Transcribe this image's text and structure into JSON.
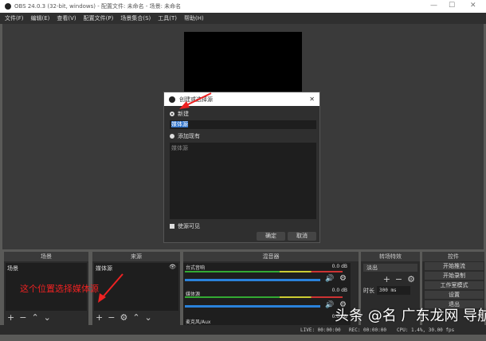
{
  "window": {
    "title": "OBS 24.0.3 (32-bit, windows) - 配置文件: 未命名 - 场景: 未命名",
    "min": "—",
    "max": "☐",
    "close": "✕"
  },
  "menu": [
    "文件(F)",
    "编辑(E)",
    "查看(V)",
    "配置文件(P)",
    "场景集合(S)",
    "工具(T)",
    "帮助(H)"
  ],
  "dialog": {
    "title": "创建或选择源",
    "new_label": "新建",
    "name_value": "媒体源",
    "existing_label": "添加现有",
    "existing_items": [
      "媒体源"
    ],
    "visible_label": "使源可见",
    "ok": "确定",
    "cancel": "取消"
  },
  "scenes": {
    "title": "场景",
    "items": [
      "场景"
    ]
  },
  "sources": {
    "title": "来源",
    "items": [
      "媒体源"
    ]
  },
  "annotation": "这个位置选择媒体源",
  "mixer": {
    "title": "混音器",
    "channels": [
      {
        "name": "台式音响",
        "db": "0.0 dB"
      },
      {
        "name": "媒体源",
        "db": "0.0 dB"
      },
      {
        "name": "麦克风/Aux",
        "db": "0.0 dB"
      }
    ]
  },
  "transitions": {
    "title": "转场特效",
    "selected": "淡出",
    "duration_label": "时长",
    "duration": "300 ms"
  },
  "controls": {
    "title": "控件",
    "buttons": [
      "开始推流",
      "开始录制",
      "工作室模式",
      "设置",
      "退出"
    ]
  },
  "status": {
    "live": "LIVE: 00:00:00",
    "rec": "REC: 00:00:00",
    "cpu": "CPU: 1.4%, 30.00 fps"
  },
  "watermark": "头条 @名 广东龙网 导航"
}
